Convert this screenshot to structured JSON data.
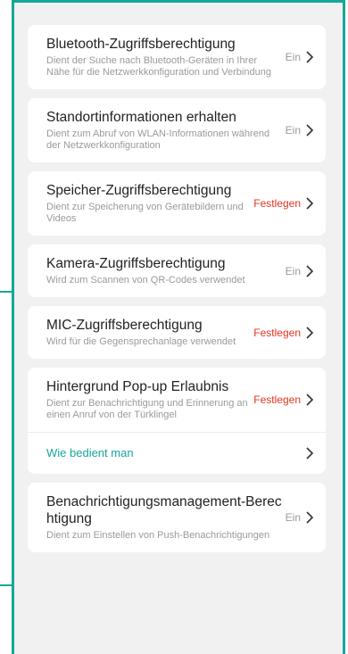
{
  "permissions": [
    {
      "title": "Bluetooth-Zugriffsberechtigung",
      "description": "Dient der Suche nach Bluetooth-Geräten in Ihrer Nähe für die Netzwerkkonfiguration und Verbindung",
      "status": "Ein",
      "status_color": "#9a9a9a"
    },
    {
      "title": "Standortinformationen erhalten",
      "description": "Dient zum Abruf von WLAN-Informationen während der Netzwerkkonfiguration",
      "status": "Ein",
      "status_color": "#9a9a9a"
    },
    {
      "title": "Speicher-Zugriffsberechtigung",
      "description": "Dient zur Speicherung von Gerätebildern und Videos",
      "status": "Festlegen",
      "status_color": "#e5331f"
    },
    {
      "title": "Kamera-Zugriffsberechtigung",
      "description": "Wird zum Scannen von QR-Codes verwendet",
      "status": "Ein",
      "status_color": "#9a9a9a"
    },
    {
      "title": "MIC-Zugriffsberechtigung",
      "description": "Wird für die Gegensprechanlage verwendet",
      "status": "Festlegen",
      "status_color": "#e5331f"
    },
    {
      "title": "Hintergrund Pop-up Erlaubnis",
      "description": "Dient zur Benachrichtigung und Erinnerung an einen Anruf von der Türklingel",
      "status": "Festlegen",
      "status_color": "#e5331f"
    },
    {
      "title": "Benachrichtigungsmanagement-Berechtigung",
      "description": "Dient zum Einstellen von Push-Benachrichtigungen",
      "status": "Ein",
      "status_color": "#9a9a9a"
    }
  ],
  "help_link": {
    "label": "Wie bedient man",
    "color": "#14a79a"
  },
  "icons": {
    "chevron": "chevron-right-icon"
  },
  "colors": {
    "accent": "#14a79a",
    "warning": "#e5331f",
    "background": "#f1f1f1"
  }
}
